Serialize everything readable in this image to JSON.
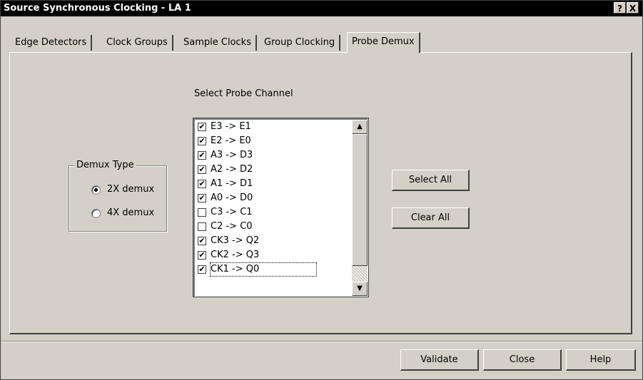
{
  "window": {
    "title": "Source Synchronous Clocking - LA 1",
    "help_button": "?",
    "close_button": "X"
  },
  "tabs": [
    {
      "label": "Edge Detectors",
      "active": false
    },
    {
      "label": "Clock Groups",
      "active": false
    },
    {
      "label": "Sample Clocks",
      "active": false
    },
    {
      "label": "Group Clocking",
      "active": false
    },
    {
      "label": "Probe Demux",
      "active": true
    }
  ],
  "demux_type": {
    "label": "Demux Type",
    "options": [
      {
        "label": "2X demux",
        "selected": true
      },
      {
        "label": "4X demux",
        "selected": false
      }
    ]
  },
  "probe_channel": {
    "label": "Select Probe Channel",
    "items": [
      {
        "label": "E3 -> E1",
        "checked": true
      },
      {
        "label": "E2 -> E0",
        "checked": true
      },
      {
        "label": "A3 -> D3",
        "checked": true
      },
      {
        "label": "A2 -> D2",
        "checked": true
      },
      {
        "label": "A1 -> D1",
        "checked": true
      },
      {
        "label": "A0 -> D0",
        "checked": true
      },
      {
        "label": "C3 -> C1",
        "checked": false
      },
      {
        "label": "C2 -> C0",
        "checked": false
      },
      {
        "label": "CK3 -> Q2",
        "checked": true
      },
      {
        "label": "CK2 -> Q3",
        "checked": true
      },
      {
        "label": "CK1 -> Q0",
        "checked": true
      }
    ]
  },
  "actions": {
    "select_all": "Select All",
    "clear_all": "Clear All"
  },
  "footer": {
    "validate": "Validate",
    "close": "Close",
    "help": "Help"
  }
}
